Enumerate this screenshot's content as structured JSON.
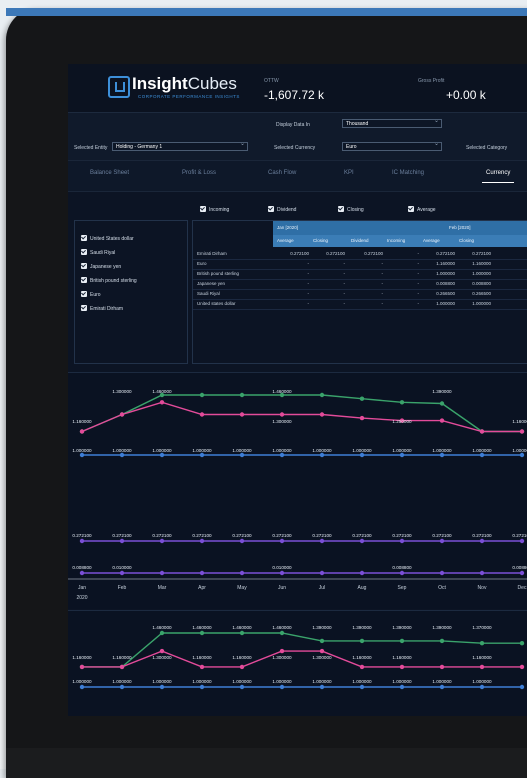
{
  "app": {
    "brand_bold": "Insight",
    "brand_light": "Cubes",
    "tagline": "CORPORATE PERFORMANCE INSIGHTS"
  },
  "kpis": [
    {
      "label": "OTTW",
      "value": "-1,607.72 k"
    },
    {
      "label": "Gross Profit",
      "value": "+0.00 k"
    }
  ],
  "controls": {
    "display_data_label": "Display Data In",
    "display_data_value": "Thousand",
    "entity_label": "Selected Entity",
    "entity_value": "Holding - Germany 1",
    "currency_label": "Selected Currency",
    "currency_value": "Euro",
    "category_label": "Selected Category"
  },
  "tabs": [
    "Balance Sheet",
    "Profit & Loss",
    "Cash Flow",
    "KPI",
    "IC Matching",
    "Currency"
  ],
  "active_tab": "Currency",
  "rate_filters": [
    "Incoming",
    "Dividend",
    "Closing",
    "Average"
  ],
  "currency_list": [
    "United States dollar",
    "Saudi Riyal",
    "Japanese yen",
    "British pound sterling",
    "Euro",
    "Emirati Dirham"
  ],
  "table": {
    "period_headers": [
      "Jan [2020]",
      "Feb [2020]"
    ],
    "col_headers": [
      "Average",
      "Closing",
      "Dividend",
      "Incoming",
      "Average",
      "Closing"
    ],
    "rows": [
      {
        "label": "Emirati Dirham",
        "cells": [
          "0.272100",
          "0.272100",
          "0.272100",
          "-",
          "0.272100",
          "0.272100"
        ]
      },
      {
        "label": "Euro",
        "cells": [
          "-",
          "-",
          "-",
          "-",
          "1.160000",
          "1.160000"
        ]
      },
      {
        "label": "British pound sterling",
        "cells": [
          "-",
          "-",
          "-",
          "-",
          "1.000000",
          "1.000000"
        ]
      },
      {
        "label": "Japanese yen",
        "cells": [
          "-",
          "-",
          "-",
          "-",
          "0.008800",
          "0.008800"
        ]
      },
      {
        "label": "Saudi Riyal",
        "cells": [
          "-",
          "-",
          "-",
          "-",
          "0.266500",
          "0.266500"
        ]
      },
      {
        "label": "United states dollar",
        "cells": [
          "-",
          "-",
          "-",
          "-",
          "1.000000",
          "1.000000"
        ]
      }
    ]
  },
  "colors": {
    "green": "#3aa36b",
    "pink": "#e34b9a",
    "orange": "#f39b2e",
    "blue": "#3e7ed6",
    "purple": "#7a4fd6"
  },
  "chart_data": [
    {
      "type": "line",
      "categories": [
        "Jan",
        "Feb",
        "Mar",
        "Apr",
        "May",
        "Jun",
        "Jul",
        "Aug",
        "Sep",
        "Oct",
        "Nov",
        "Dec"
      ],
      "series": [
        {
          "values": [
            1.16,
            1.3,
            1.46,
            1.46,
            1.46,
            1.46,
            1.46,
            1.43,
            1.4,
            1.39,
            1.16,
            1.16
          ]
        },
        {
          "values": [
            1.16,
            1.3,
            1.4,
            1.3,
            1.3,
            1.3,
            1.3,
            1.27,
            1.25,
            1.25,
            1.16,
            1.16
          ]
        },
        {
          "values": [
            1.0,
            1.0,
            1.0,
            1.0,
            1.0,
            1.0,
            1.0,
            1.0,
            1.0,
            1.0,
            1.0,
            1.0
          ]
        },
        {
          "values": [
            0.2721,
            0.2721,
            0.2721,
            0.2721,
            0.2721,
            0.2721,
            0.2721,
            0.2721,
            0.2721,
            0.2721,
            0.2721,
            0.2721
          ]
        },
        {
          "values": [
            0.0088,
            0.01,
            0.01,
            0.01,
            0.01,
            0.01,
            0.01,
            0.01,
            0.0088,
            0.0088,
            0.0088,
            0.0088
          ]
        }
      ],
      "point_labels": {
        "top": [
          "",
          "1.300000",
          "1.460000",
          "",
          "",
          "1.460000",
          "",
          "",
          "",
          "1.390000",
          "",
          ""
        ],
        "mid": [
          "1.160000",
          "",
          "",
          "",
          "",
          "1.300000",
          "",
          "",
          "1.250000",
          "",
          "",
          "1.160000"
        ],
        "base": [
          "1.000000",
          "1.000000",
          "1.000000",
          "1.000000",
          "1.000000",
          "1.000000",
          "1.000000",
          "1.000000",
          "1.000000",
          "1.000000",
          "1.000000",
          "1.000000"
        ],
        "aed": [
          "0.272100",
          "0.272100",
          "0.272100",
          "0.272100",
          "0.272100",
          "0.272100",
          "0.272100",
          "0.272100",
          "0.272100",
          "0.272100",
          "0.272100",
          "0.272100"
        ],
        "jpy": [
          "0.008800",
          "0.010000",
          "",
          "",
          "",
          "0.010000",
          "",
          "",
          "0.008800",
          "",
          "",
          "0.008800"
        ]
      },
      "year_label": "2020"
    },
    {
      "type": "line",
      "categories": [
        "Jan",
        "Feb",
        "Mar",
        "Apr",
        "May",
        "Jun",
        "Jul",
        "Aug",
        "Sep",
        "Oct",
        "Nov",
        "Dec"
      ],
      "series": [
        {
          "values": [
            1.16,
            1.16,
            1.46,
            1.46,
            1.46,
            1.46,
            1.39,
            1.39,
            1.39,
            1.39,
            1.37,
            1.37
          ]
        },
        {
          "values": [
            1.16,
            1.16,
            1.3,
            1.16,
            1.16,
            1.3,
            1.3,
            1.16,
            1.16,
            1.16,
            1.16,
            1.16
          ]
        },
        {
          "values": [
            1.0,
            1.0,
            1.0,
            1.0,
            1.0,
            1.0,
            1.0,
            1.0,
            1.0,
            1.0,
            1.0,
            1.0
          ]
        }
      ],
      "point_labels": {
        "top": [
          "",
          "",
          "1.460000",
          "1.460000",
          "1.460000",
          "1.460000",
          "1.390000",
          "1.390000",
          "1.390000",
          "1.390000",
          "1.370000",
          ""
        ],
        "mid": [
          "1.160000",
          "1.160000",
          "1.300000",
          "1.160000",
          "1.160000",
          "1.300000",
          "1.300000",
          "1.160000",
          "1.160000",
          "",
          "1.160000",
          ""
        ],
        "base": [
          "1.000000",
          "1.000000",
          "1.000000",
          "1.000000",
          "1.000000",
          "1.000000",
          "1.000000",
          "1.000000",
          "1.000000",
          "1.000000",
          "1.000000",
          ""
        ]
      }
    }
  ]
}
